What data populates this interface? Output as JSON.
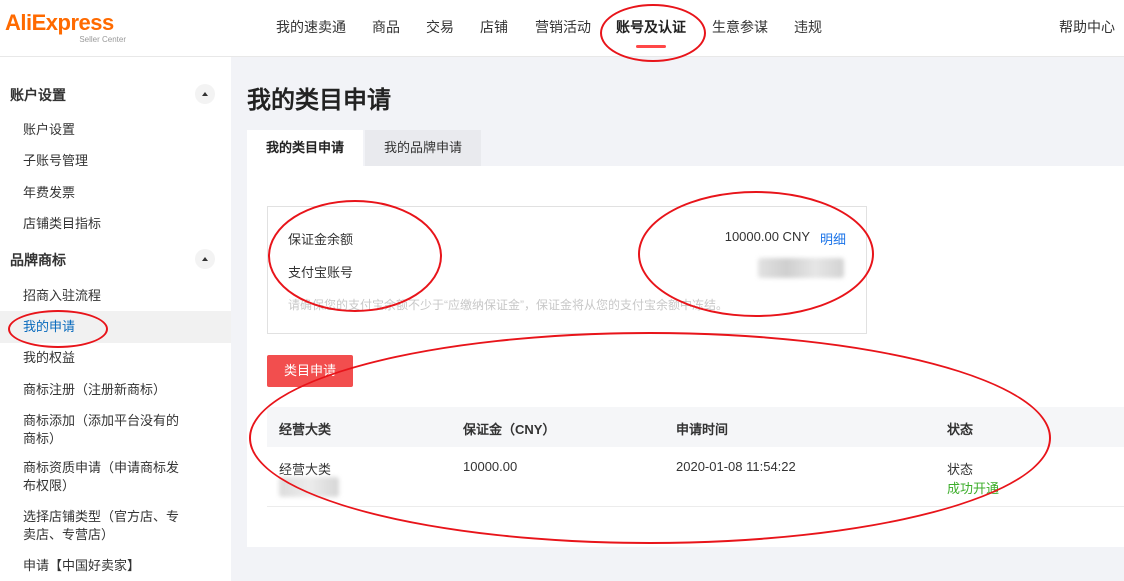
{
  "header": {
    "logo_brand": "AliExpress",
    "logo_sub": "Seller Center",
    "nav": [
      "我的速卖通",
      "商品",
      "交易",
      "店铺",
      "营销活动",
      "账号及认证",
      "生意参谋",
      "违规"
    ],
    "active_nav": "账号及认证",
    "help": "帮助中心"
  },
  "sidebar": {
    "sections": [
      {
        "title": "账户设置",
        "items": [
          "账户设置",
          "子账号管理",
          "年费发票",
          "店铺类目指标"
        ]
      },
      {
        "title": "品牌商标",
        "items": [
          "招商入驻流程",
          "我的申请",
          "我的权益",
          "商标注册（注册新商标）",
          "商标添加（添加平台没有的商标）",
          "商标资质申请（申请商标发布权限）",
          "选择店铺类型（官方店、专卖店、专营店）",
          "申请【中国好卖家】"
        ]
      }
    ],
    "active_item": "我的申请"
  },
  "main": {
    "title": "我的类目申请",
    "tabs": [
      "我的类目申请",
      "我的品牌申请"
    ],
    "active_tab": "我的类目申请",
    "deposit": {
      "balance_label": "保证金余额",
      "balance_value": "10000.00 CNY",
      "detail_link": "明细",
      "alipay_label": "支付宝账号",
      "note": "请确保您的支付宝余额不少于“应缴纳保证金”，保证金将从您的支付宝余额中冻结。"
    },
    "apply_button": "类目申请",
    "table": {
      "columns": [
        "经营大类",
        "保证金（CNY）",
        "申请时间",
        "状态"
      ],
      "rows": [
        {
          "category": "经营大类",
          "deposit": "10000.00",
          "time": "2020-01-08 11:54:22",
          "status_label": "状态",
          "status": "成功开通"
        }
      ]
    }
  },
  "colors": {
    "brand": "#ff6a00",
    "active_nav_underline": "#ff4747",
    "apply_button": "#f24e4e",
    "link": "#1a73e8",
    "sidebar_active": "#0a6bbd",
    "success": "#3dae2b",
    "annotation": "#e8141a"
  }
}
